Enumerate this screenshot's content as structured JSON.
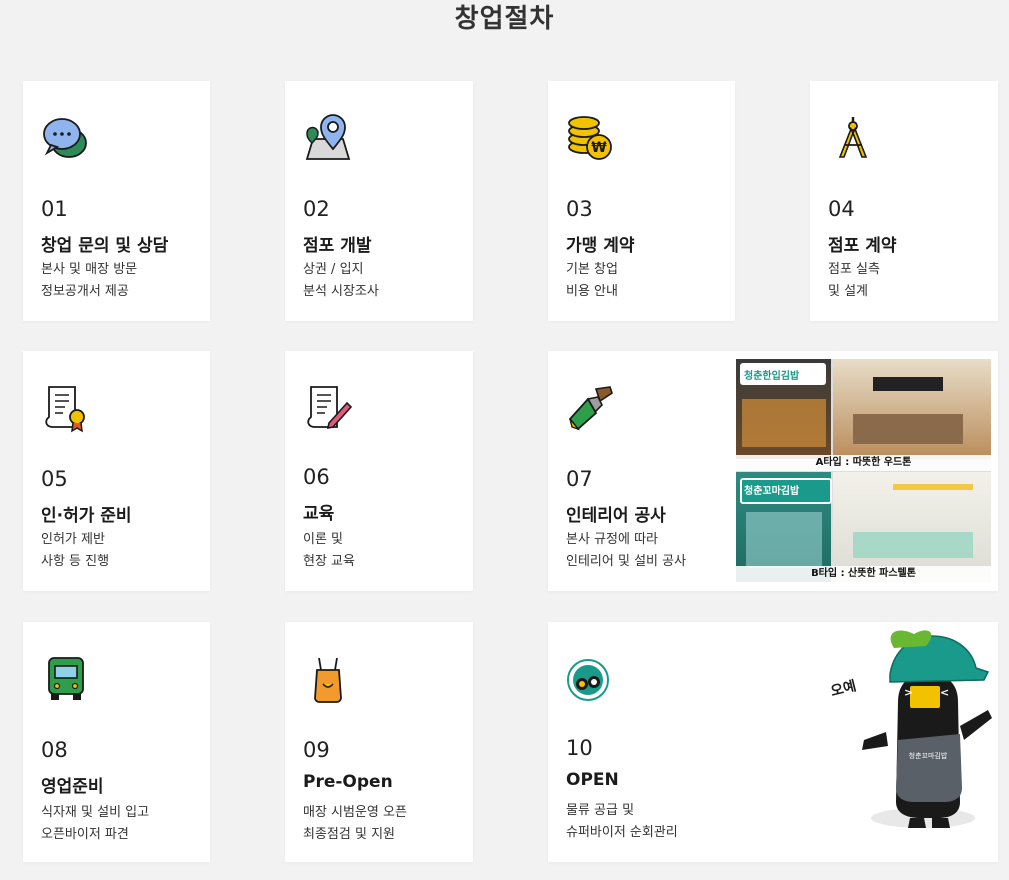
{
  "page": {
    "title": "창업절차"
  },
  "steps": [
    {
      "num": "01",
      "title": "창업 문의 및 상담",
      "desc": [
        "본사 및 매장 방문",
        "정보공개서 제공"
      ],
      "icon": "chat-bubbles-icon"
    },
    {
      "num": "02",
      "title": "점포 개발",
      "desc": [
        "상권 / 입지",
        "분석 시장조사"
      ],
      "icon": "map-pin-icon"
    },
    {
      "num": "03",
      "title": "가맹 계약",
      "desc": [
        "기본 창업",
        "비용 안내"
      ],
      "icon": "coins-won-icon"
    },
    {
      "num": "04",
      "title": "점포 계약",
      "desc": [
        "점포 실측",
        "및 설계"
      ],
      "icon": "compass-icon"
    },
    {
      "num": "05",
      "title": "인·허가 준비",
      "desc": [
        "인허가 제반",
        "사항 등 진행"
      ],
      "icon": "certificate-icon"
    },
    {
      "num": "06",
      "title": "교육",
      "desc": [
        "이론 및",
        "현장 교육"
      ],
      "icon": "document-pen-icon"
    },
    {
      "num": "07",
      "title": "인테리어 공사",
      "desc": [
        "본사 규정에 따라",
        "인테리어 및 설비 공사"
      ],
      "icon": "paint-brush-icon"
    },
    {
      "num": "08",
      "title": "영업준비",
      "desc": [
        "식자재 및 설비 입고",
        "오픈바이저 파견"
      ],
      "icon": "truck-icon"
    },
    {
      "num": "09",
      "title": "Pre-Open",
      "desc": [
        "매장 시범운영 오픈",
        "최종점검 및 지원"
      ],
      "icon": "apron-icon"
    },
    {
      "num": "10",
      "title": "OPEN",
      "desc": [
        "물류 공급 및",
        "슈퍼바이저 순회관리"
      ],
      "icon": "brand-logo-icon"
    }
  ],
  "interior": {
    "type_a_caption": "A타입 : 따뜻한 우드톤",
    "type_b_caption": "B타입 : 산뜻한 파스텔톤",
    "store_sign_a": "청춘한입김밥",
    "store_sign_b": "청춘꼬마김밥"
  },
  "mascot": {
    "exclamation": "오예",
    "apron_text": "청춘꼬마김밥"
  },
  "colors": {
    "background": "#f2f2f2",
    "card": "#ffffff",
    "text": "#222222",
    "brand_green": "#1a9a8a"
  }
}
